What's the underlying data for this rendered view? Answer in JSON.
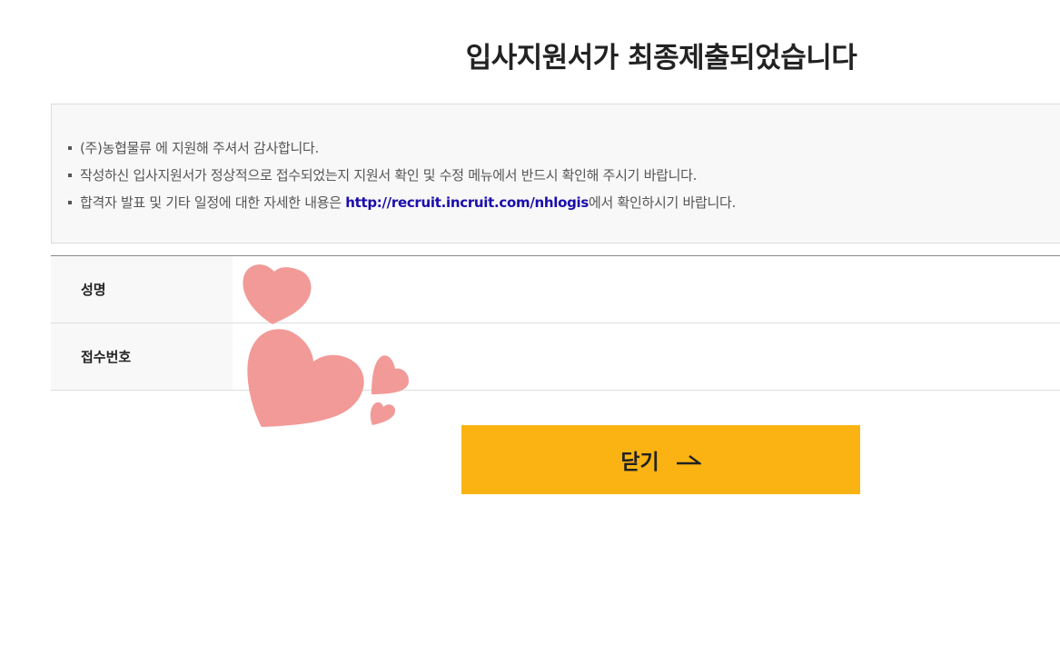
{
  "page": {
    "title": "입사지원서가 최종제출되었습니다"
  },
  "notice": {
    "items": [
      {
        "text": "(주)농협물류 에 지원해 주셔서 감사합니다."
      },
      {
        "text": "작성하신 입사지원서가 정상적으로 접수되었는지 지원서 확인 및 수정 메뉴에서 반드시 확인해 주시기 바랍니다."
      },
      {
        "before": "합격자 발표 및 기타 일정에 대한 자세한 내용은 ",
        "link": "http://recruit.incruit.com/nhlogis",
        "after": "에서 확인하시기 바랍니다."
      }
    ]
  },
  "info": {
    "name_label": "성명",
    "name_value": "",
    "receipt_label": "접수번호",
    "receipt_value": ""
  },
  "close_button": {
    "label": "닫기",
    "arrow_icon": "arrow-right-icon"
  },
  "colors": {
    "button": "#fab312",
    "heart": "#f29a98",
    "link": "#1a0dab"
  }
}
